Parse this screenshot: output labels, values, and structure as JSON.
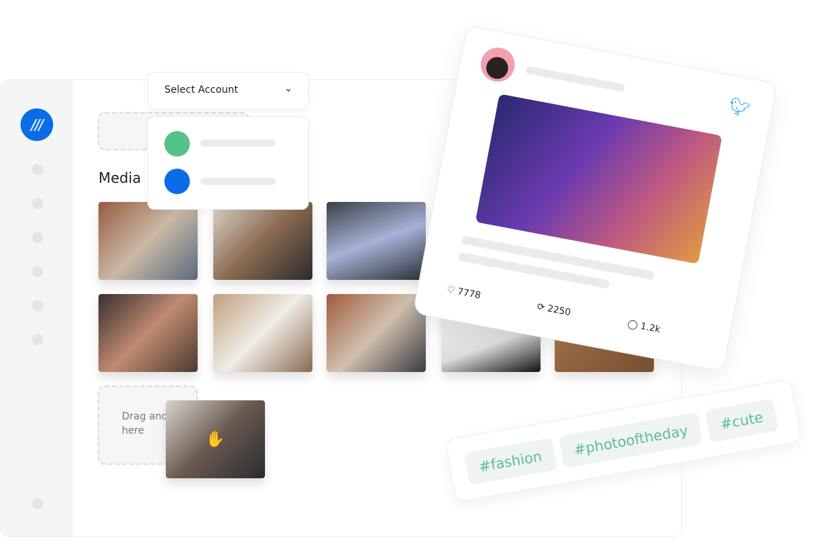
{
  "sidebar": {
    "logo_icon": "brand-logo",
    "items": 7
  },
  "media": {
    "title": "Media",
    "drop_text": "Drag and drop here",
    "photos": [
      {
        "alt": "team high five"
      },
      {
        "alt": "woman on laptop"
      },
      {
        "alt": "skyscrapers"
      },
      {
        "alt": "group at cafe"
      },
      {
        "alt": "man on phone"
      },
      {
        "alt": "office presentation"
      },
      {
        "alt": "chart on laptop"
      },
      {
        "alt": "wooden table"
      }
    ],
    "dragged_photo": "conference room"
  },
  "account_select": {
    "label": "Select Account",
    "accounts": [
      {
        "color": "#56c28a"
      },
      {
        "color": "#0a6ce6"
      }
    ]
  },
  "post": {
    "network_icon": "twitter-icon",
    "image": "person wearing VR headset",
    "likes": "7778",
    "retweets": "2250",
    "replies": "1.2k"
  },
  "hashtags": [
    "#fashion",
    "#photooftheday",
    "#cute"
  ],
  "colors": {
    "brand": "#0a6ce6",
    "hashtag": "#5bc08a",
    "twitter": "#1da1f2"
  }
}
